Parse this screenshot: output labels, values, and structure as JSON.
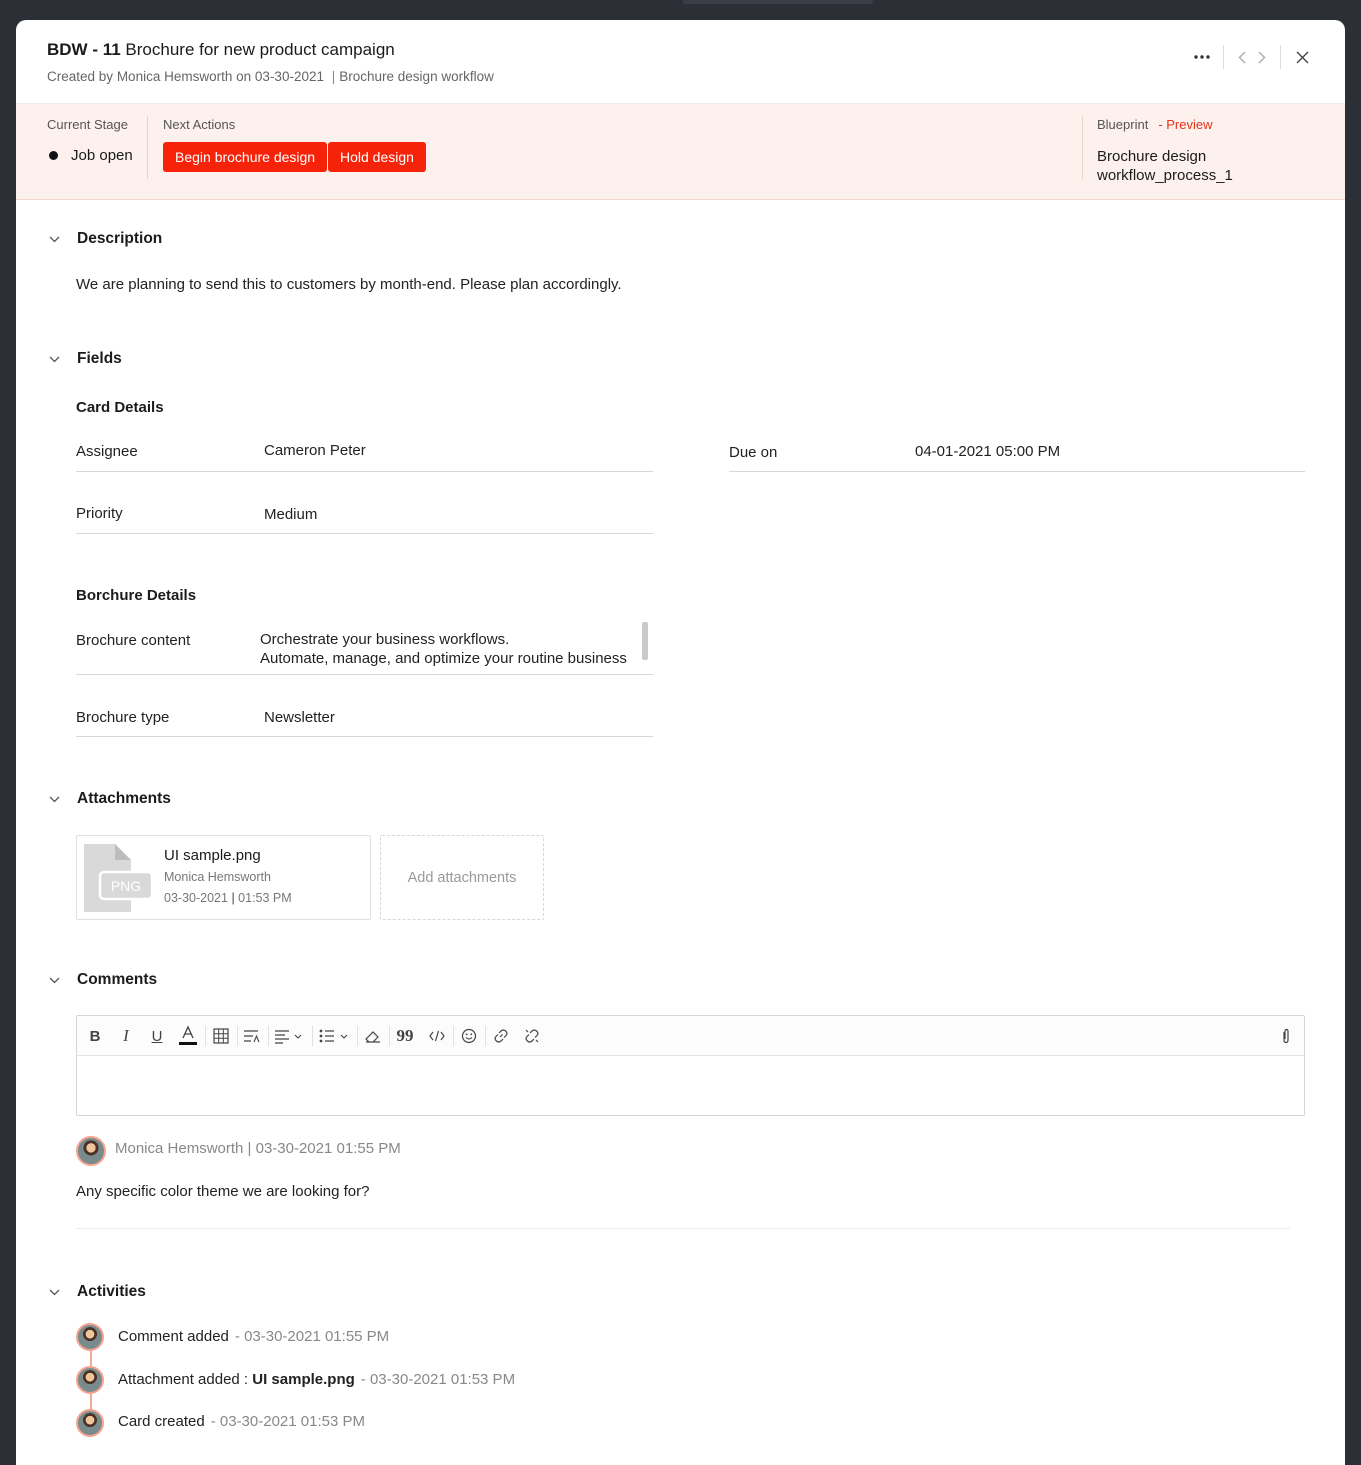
{
  "header": {
    "card_id": "BDW - 11",
    "card_title": "Brochure for new product campaign",
    "created_by_label": "Created by",
    "created_by": "Monica Hemsworth",
    "created_on_label": "on",
    "created_on": "03-30-2021",
    "workflow": "Brochure design workflow"
  },
  "stage": {
    "current_stage_label": "Current Stage",
    "current_stage": "Job open",
    "next_actions_label": "Next Actions",
    "actions": [
      "Begin brochure design",
      "Hold design"
    ],
    "blueprint_label": "Blueprint",
    "preview_label": "- Preview",
    "blueprint_line1": "Brochure design",
    "blueprint_line2": "workflow_process_1",
    "accent_color": "#f6230a"
  },
  "description": {
    "heading": "Description",
    "text": "We are planning to send this to customers by month-end. Please plan accordingly."
  },
  "fields": {
    "heading": "Fields",
    "card_details_heading": "Card Details",
    "assignee_label": "Assignee",
    "assignee": "Cameron Peter",
    "due_label": "Due on",
    "due": "04-01-2021 05:00 PM",
    "priority_label": "Priority",
    "priority": "Medium",
    "brochure_heading": "Borchure Details",
    "content_label": "Brochure content",
    "content_line1": "Orchestrate your business workflows.",
    "content_line2": "Automate, manage, and optimize your routine business",
    "type_label": "Brochure type",
    "type": "Newsletter"
  },
  "attachments": {
    "heading": "Attachments",
    "file_name": "UI sample.png",
    "file_ext": "PNG",
    "uploader": "Monica Hemsworth",
    "date": "03-30-2021",
    "time": "01:53 PM",
    "add_label": "Add attachments"
  },
  "comments": {
    "heading": "Comments",
    "toolbar_icons": [
      "bold-icon",
      "italic-icon",
      "underline-icon",
      "font-color-icon",
      "table-icon",
      "text-format-icon",
      "align-icon",
      "list-icon",
      "eraser-icon",
      "quote-icon",
      "code-icon",
      "emoji-icon",
      "link-icon",
      "unlink-icon",
      "attach-icon"
    ],
    "items": [
      {
        "author": "Monica Hemsworth",
        "timestamp": "03-30-2021 01:55 PM",
        "text": "Any specific color theme we are looking for?"
      }
    ]
  },
  "activities": {
    "heading": "Activities",
    "items": [
      {
        "text": "Comment added",
        "bold": "",
        "time": "- 03-30-2021 01:55 PM"
      },
      {
        "text": "Attachment added : ",
        "bold": "UI sample.png",
        "time": "- 03-30-2021 01:53 PM"
      },
      {
        "text": "Card created",
        "bold": "",
        "time": "- 03-30-2021 01:53 PM"
      }
    ]
  }
}
